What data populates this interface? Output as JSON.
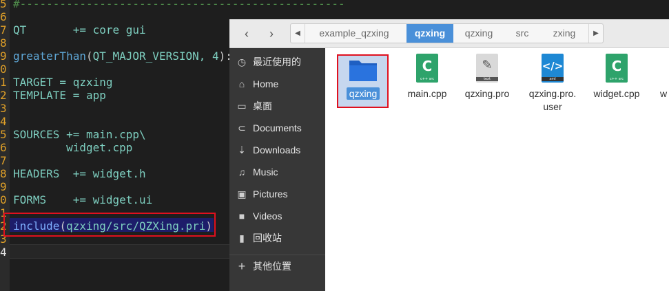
{
  "editor": {
    "gutter_numbers": [
      "5",
      "6",
      "7",
      "8",
      "9",
      "0",
      "1",
      "2",
      "3",
      "4",
      "5",
      "6",
      "7",
      "8",
      "9",
      "0",
      "1",
      "2",
      "3",
      "4"
    ],
    "lines": {
      "l1": "#-------------------------------------------------",
      "l3_a": "QT",
      "l3_b": "+= core gui",
      "l5_fn": "greaterThan",
      "l5_p1": "(",
      "l5_arg": "QT_MAJOR_VERSION, 4",
      "l5_p2": "):",
      "l7": "TARGET = qzxing",
      "l8": "TEMPLATE = app",
      "l11": "SOURCES += main.cpp\\",
      "l12": "        widget.cpp",
      "l14": "HEADERS  += widget.h",
      "l16": "FORMS    += widget.ui",
      "l18_kw": "include",
      "l18_p1": "(",
      "l18_arg": "qzxing/src/QZXing.pri",
      "l18_p2": ")"
    }
  },
  "dialog": {
    "nav": {
      "back_icon": "‹",
      "forward_icon": "›"
    },
    "path": [
      "example_qzxing",
      "qzxing",
      "qzxing",
      "src",
      "zxing"
    ],
    "active_crumb_index": 1,
    "sidebar": [
      {
        "icon": "clock-icon",
        "glyph": "◷",
        "label": "最近使用的"
      },
      {
        "icon": "home-icon",
        "glyph": "⌂",
        "label": "Home"
      },
      {
        "icon": "desktop-icon",
        "glyph": "▭",
        "label": "桌面"
      },
      {
        "icon": "documents-icon",
        "glyph": "⊂",
        "label": "Documents"
      },
      {
        "icon": "downloads-icon",
        "glyph": "⇣",
        "label": "Downloads"
      },
      {
        "icon": "music-icon",
        "glyph": "♫",
        "label": "Music"
      },
      {
        "icon": "pictures-icon",
        "glyph": "▣",
        "label": "Pictures"
      },
      {
        "icon": "videos-icon",
        "glyph": "■",
        "label": "Videos"
      },
      {
        "icon": "trash-icon",
        "glyph": "▮",
        "label": "回收站"
      },
      {
        "icon": "plus-icon",
        "glyph": "+",
        "label": "其他位置"
      }
    ],
    "files": [
      {
        "name": "qzxing",
        "type": "folder"
      },
      {
        "name": "main.cpp",
        "type": "cpp",
        "tag": "c++ src"
      },
      {
        "name": "qzxing.pro",
        "type": "text",
        "tag": "text"
      },
      {
        "name": "qzxing.pro.\nuser",
        "type": "xml",
        "tag": "xml"
      },
      {
        "name": "widget.cpp",
        "type": "cpp",
        "tag": "c++ src"
      },
      {
        "name": "w",
        "type": "partial"
      }
    ],
    "colors": {
      "accent": "#4a90d9",
      "cpp": "#2ea36b",
      "xml": "#1e88d4",
      "text": "#cfcfcf",
      "highlight": "#e0101e"
    }
  }
}
